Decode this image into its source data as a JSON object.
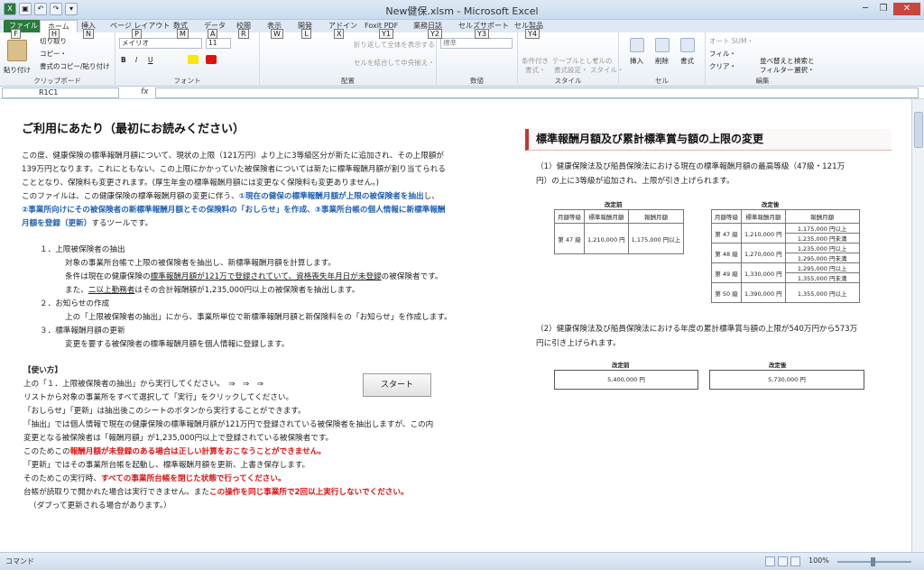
{
  "window": {
    "title": "New健保.xlsm - Microsoft Excel",
    "controls": [
      "─",
      "❐",
      "✕",
      "?",
      "─",
      "❐",
      "✕"
    ]
  },
  "qat": [
    "X",
    "▣",
    "↶",
    "↷",
    "▾"
  ],
  "tabs": [
    {
      "label": "ファイル",
      "key": "F"
    },
    {
      "label": "ホーム",
      "key": "H"
    },
    {
      "label": "挿入",
      "key": "N"
    },
    {
      "label": "ページ レイアウト",
      "key": "P"
    },
    {
      "label": "数式",
      "key": "M"
    },
    {
      "label": "データ",
      "key": "A"
    },
    {
      "label": "校閲",
      "key": "R"
    },
    {
      "label": "表示",
      "key": "W"
    },
    {
      "label": "開発",
      "key": "L"
    },
    {
      "label": "アドイン",
      "key": "X"
    },
    {
      "label": "Foxit PDF",
      "key": "Y1"
    },
    {
      "label": "業務日誌",
      "key": "Y2"
    },
    {
      "label": "セルズサポート",
      "key": "Y3"
    },
    {
      "label": "セル製品",
      "key": "Y4"
    }
  ],
  "ribbon": {
    "clipboard": {
      "label": "クリップボード",
      "paste": "貼り付け",
      "cut": "切り取り",
      "copy": "コピー・",
      "format_painter": "書式のコピー/貼り付け"
    },
    "font": {
      "label": "フォント",
      "name": "メイリオ",
      "size": "11"
    },
    "alignment": {
      "label": "配置",
      "wrap": "折り返して全体を表示する",
      "merge": "セルを結合して中央揃え・"
    },
    "number": {
      "label": "数値",
      "format": "標準"
    },
    "styles": {
      "label": "スタイル",
      "conditional": "条件付き",
      "conditional2": "書式・",
      "table": "テーブルとして",
      "table2": "書式設定・",
      "cell": "セルの",
      "cell2": "スタイル・"
    },
    "cells": {
      "label": "セル",
      "insert": "挿入",
      "delete": "削除",
      "format": "書式"
    },
    "editing": {
      "label": "編集",
      "autosum": "オート SUM・",
      "fill": "フィル・",
      "clear": "クリア・",
      "sort": "並べ替えと",
      "sort2": "フィルター・",
      "find": "検索と",
      "find2": "選択・"
    }
  },
  "formula": {
    "namebox": "R1C1",
    "fx": "fx"
  },
  "left": {
    "heading": "ご利用にあたり（最初にお読みください）",
    "intro": [
      "この度、健康保険の標準報酬月額について、現状の上限（121万円）より上に3等級区分が新たに追加され、その上限額が",
      "139万円となります。これにともない、この上限にかかっていた被保険者については新たに標準報酬月額が割り当てられる",
      "こととなり、保険料も変更されます。(厚生年金の標準報酬月額には変更なく保険料も変更ありません。)"
    ],
    "l4a": "このファイルは、この健康保険の標準報酬月額の変更に伴う、",
    "l4b": "①現在の健保の標準報酬月額が上限の被保険者を抽出",
    "l4c": "し、",
    "l5": "②事業所向けにその被保険者の新標準報酬月額とその保険料の「おしらせ」を作成、③事業所台帳の個人情報に新標準報酬",
    "l6a": "月額を登録（更新）",
    "l6b": "するツールです。",
    "s1": "１．上限被保険者の抽出",
    "s1a": "対象の事業所台帳で上限の被保険者を抽出し、新標準報酬月額を計算します。",
    "s1b1": "条件は現在の健康保険の",
    "s1b2": "標準報酬月額が121万で登録されていて、資格喪失年月日が未登録",
    "s1b3": "の被保険者です。",
    "s1c1": "また、",
    "s1c2": "二以上勤務者",
    "s1c3": "はその合計報酬額が1,235,000円以上の被保険者を抽出します。",
    "s2": "２．お知らせの作成",
    "s2a": "上の「上限被保険者の抽出」にから、事業所単位で新標準報酬月額と新保険料をの「お知らせ」を作成します。",
    "s3": "３．標準報酬月額の更新",
    "s3a": "変更を要する被保険者の標準報酬月額を個人情報に登録します。",
    "howto": "【使い方】",
    "u1": "上の「１．上限被保険者の抽出」から実行してください。　⇒　⇒　⇒",
    "u2": "リストから対象の事業所をすべて選択して「実行」をクリックしてください。",
    "u3": "「おしらせ」「更新」は抽出後このシートのボタンから実行することができます。",
    "u4": "「抽出」では個人情報で現在の健康保険の標準報酬月額が121万円で登録されている被保険者を抽出しますが、この内",
    "u5": "変更となる被保険者は「報酬月額」が1,235,000円以上で登録されている被保険者です。",
    "u6a": "このためこの",
    "u6b": "報酬月額が未登録のある場合は正しい計算をおこなうことができません。",
    "u7": "「更新」ではその事業所台帳を起動し、標準報酬月額を更新、上書き保存します。",
    "u8a": "そのためこの実行時、",
    "u8b": "すべての事業所台帳を閉じた状態で行ってください。",
    "u9a": "台帳が読取りで開かれた場合は実行できません。また",
    "u9b": "この操作を同じ事業所で2回以上実行しないでください。",
    "u10": "（ダブって更新される場合があります。）",
    "start": "スタート"
  },
  "right": {
    "heading": "標準報酬月額及び累計標準賞与額の上限の変更",
    "p1a": "（1）健康保険法及び船員保険法における現在の標準報酬月額の最高等級（47級・121万",
    "p1b": "円）の上に3等級が追加され、上限が引き上げられます。",
    "before_cap": "改定前",
    "after_cap": "改定後",
    "headers": [
      "月額等級",
      "標準報酬月額",
      "報酬月額"
    ],
    "before_row": [
      "第 47 級",
      "1,210,000 円",
      "1,175,000 円以上"
    ],
    "after_rows": [
      [
        "第 47 級",
        "1,210,000 円",
        "1,175,000 円以上",
        "1,235,000 円未満"
      ],
      [
        "第 48 級",
        "1,270,000 円",
        "1,235,000 円以上",
        "1,295,000 円未満"
      ],
      [
        "第 49 級",
        "1,330,000 円",
        "1,295,000 円以上",
        "1,355,000 円未満"
      ],
      [
        "第 50 級",
        "1,390,000 円",
        "1,355,000 円以上",
        ""
      ]
    ],
    "p2a": "（2）健康保険法及び船員保険法における年度の累計標準賞与額の上限が540万円から573万",
    "p2b": "円に引き上げられます。",
    "sum_before": "5,400,000 円",
    "sum_after": "5,730,000 円"
  },
  "status": {
    "mode": "コマンド",
    "zoom": "100%"
  },
  "colors": {
    "file_tab": "#2a7a3b",
    "accent_red": "#e01010",
    "accent_blue": "#1f5fb4",
    "heading_bar": "#c0392b"
  }
}
